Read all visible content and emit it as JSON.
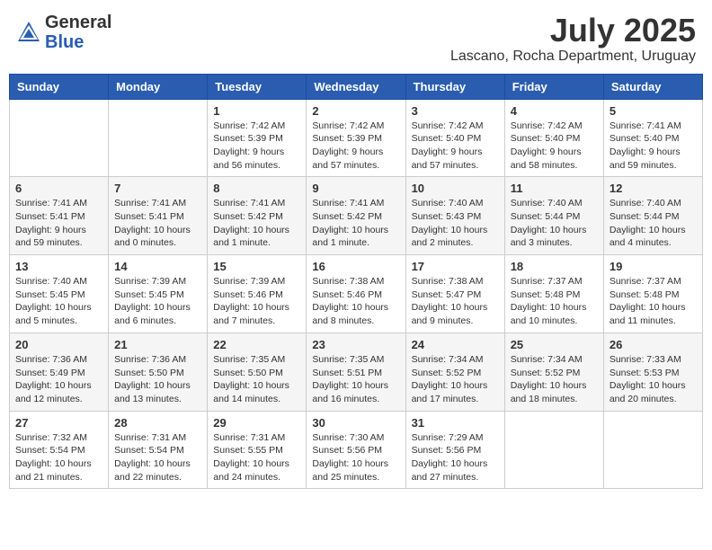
{
  "header": {
    "logo_general": "General",
    "logo_blue": "Blue",
    "month": "July 2025",
    "location": "Lascano, Rocha Department, Uruguay"
  },
  "days_of_week": [
    "Sunday",
    "Monday",
    "Tuesday",
    "Wednesday",
    "Thursday",
    "Friday",
    "Saturday"
  ],
  "weeks": [
    [
      {
        "day": "",
        "info": ""
      },
      {
        "day": "",
        "info": ""
      },
      {
        "day": "1",
        "info": "Sunrise: 7:42 AM\nSunset: 5:39 PM\nDaylight: 9 hours and 56 minutes."
      },
      {
        "day": "2",
        "info": "Sunrise: 7:42 AM\nSunset: 5:39 PM\nDaylight: 9 hours and 57 minutes."
      },
      {
        "day": "3",
        "info": "Sunrise: 7:42 AM\nSunset: 5:40 PM\nDaylight: 9 hours and 57 minutes."
      },
      {
        "day": "4",
        "info": "Sunrise: 7:42 AM\nSunset: 5:40 PM\nDaylight: 9 hours and 58 minutes."
      },
      {
        "day": "5",
        "info": "Sunrise: 7:41 AM\nSunset: 5:40 PM\nDaylight: 9 hours and 59 minutes."
      }
    ],
    [
      {
        "day": "6",
        "info": "Sunrise: 7:41 AM\nSunset: 5:41 PM\nDaylight: 9 hours and 59 minutes."
      },
      {
        "day": "7",
        "info": "Sunrise: 7:41 AM\nSunset: 5:41 PM\nDaylight: 10 hours and 0 minutes."
      },
      {
        "day": "8",
        "info": "Sunrise: 7:41 AM\nSunset: 5:42 PM\nDaylight: 10 hours and 1 minute."
      },
      {
        "day": "9",
        "info": "Sunrise: 7:41 AM\nSunset: 5:42 PM\nDaylight: 10 hours and 1 minute."
      },
      {
        "day": "10",
        "info": "Sunrise: 7:40 AM\nSunset: 5:43 PM\nDaylight: 10 hours and 2 minutes."
      },
      {
        "day": "11",
        "info": "Sunrise: 7:40 AM\nSunset: 5:44 PM\nDaylight: 10 hours and 3 minutes."
      },
      {
        "day": "12",
        "info": "Sunrise: 7:40 AM\nSunset: 5:44 PM\nDaylight: 10 hours and 4 minutes."
      }
    ],
    [
      {
        "day": "13",
        "info": "Sunrise: 7:40 AM\nSunset: 5:45 PM\nDaylight: 10 hours and 5 minutes."
      },
      {
        "day": "14",
        "info": "Sunrise: 7:39 AM\nSunset: 5:45 PM\nDaylight: 10 hours and 6 minutes."
      },
      {
        "day": "15",
        "info": "Sunrise: 7:39 AM\nSunset: 5:46 PM\nDaylight: 10 hours and 7 minutes."
      },
      {
        "day": "16",
        "info": "Sunrise: 7:38 AM\nSunset: 5:46 PM\nDaylight: 10 hours and 8 minutes."
      },
      {
        "day": "17",
        "info": "Sunrise: 7:38 AM\nSunset: 5:47 PM\nDaylight: 10 hours and 9 minutes."
      },
      {
        "day": "18",
        "info": "Sunrise: 7:37 AM\nSunset: 5:48 PM\nDaylight: 10 hours and 10 minutes."
      },
      {
        "day": "19",
        "info": "Sunrise: 7:37 AM\nSunset: 5:48 PM\nDaylight: 10 hours and 11 minutes."
      }
    ],
    [
      {
        "day": "20",
        "info": "Sunrise: 7:36 AM\nSunset: 5:49 PM\nDaylight: 10 hours and 12 minutes."
      },
      {
        "day": "21",
        "info": "Sunrise: 7:36 AM\nSunset: 5:50 PM\nDaylight: 10 hours and 13 minutes."
      },
      {
        "day": "22",
        "info": "Sunrise: 7:35 AM\nSunset: 5:50 PM\nDaylight: 10 hours and 14 minutes."
      },
      {
        "day": "23",
        "info": "Sunrise: 7:35 AM\nSunset: 5:51 PM\nDaylight: 10 hours and 16 minutes."
      },
      {
        "day": "24",
        "info": "Sunrise: 7:34 AM\nSunset: 5:52 PM\nDaylight: 10 hours and 17 minutes."
      },
      {
        "day": "25",
        "info": "Sunrise: 7:34 AM\nSunset: 5:52 PM\nDaylight: 10 hours and 18 minutes."
      },
      {
        "day": "26",
        "info": "Sunrise: 7:33 AM\nSunset: 5:53 PM\nDaylight: 10 hours and 20 minutes."
      }
    ],
    [
      {
        "day": "27",
        "info": "Sunrise: 7:32 AM\nSunset: 5:54 PM\nDaylight: 10 hours and 21 minutes."
      },
      {
        "day": "28",
        "info": "Sunrise: 7:31 AM\nSunset: 5:54 PM\nDaylight: 10 hours and 22 minutes."
      },
      {
        "day": "29",
        "info": "Sunrise: 7:31 AM\nSunset: 5:55 PM\nDaylight: 10 hours and 24 minutes."
      },
      {
        "day": "30",
        "info": "Sunrise: 7:30 AM\nSunset: 5:56 PM\nDaylight: 10 hours and 25 minutes."
      },
      {
        "day": "31",
        "info": "Sunrise: 7:29 AM\nSunset: 5:56 PM\nDaylight: 10 hours and 27 minutes."
      },
      {
        "day": "",
        "info": ""
      },
      {
        "day": "",
        "info": ""
      }
    ]
  ]
}
